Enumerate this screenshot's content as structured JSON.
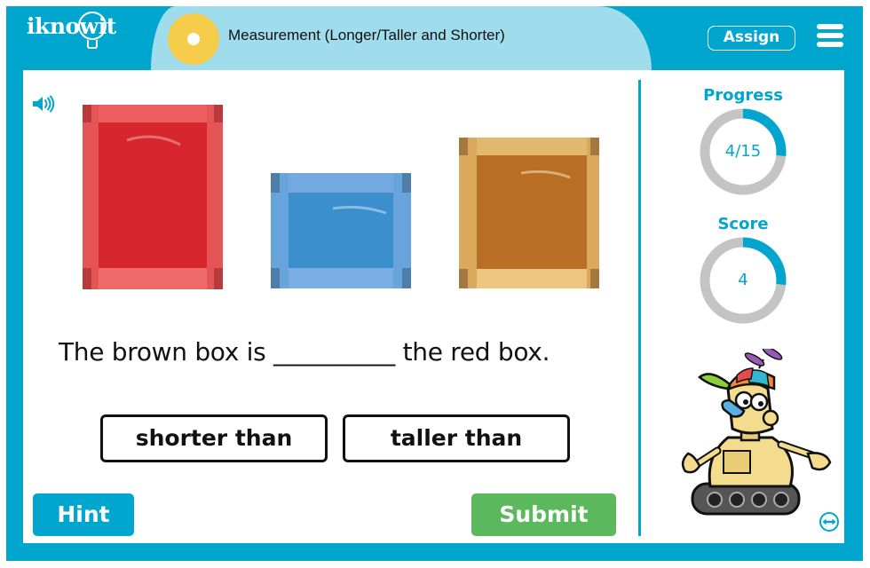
{
  "header": {
    "logo_text": "iknowit",
    "lesson_title": "Measurement (Longer/Taller and Shorter)",
    "assign_label": "Assign",
    "menu_icon": "hamburger-menu-icon"
  },
  "question": {
    "audio_icon": "speaker-icon",
    "images": [
      {
        "name": "red box",
        "color": "#e0393d"
      },
      {
        "name": "blue box",
        "color": "#3f93cf"
      },
      {
        "name": "brown box",
        "color": "#c07a30"
      }
    ],
    "prompt": "The brown box is __________ the red box.",
    "choices": [
      "shorter than",
      "taller than"
    ]
  },
  "actions": {
    "hint_label": "Hint",
    "submit_label": "Submit"
  },
  "sidebar": {
    "progress_label": "Progress",
    "progress_text": "4/15",
    "progress_value": 4,
    "progress_total": 15,
    "score_label": "Score",
    "score_text": "4",
    "score_value": 4,
    "score_total": 15,
    "expand_icon": "resize-arrows-icon"
  },
  "colors": {
    "brand": "#00a6ce",
    "title_bg": "#9fdcec",
    "title_dot": "#f5cd4b",
    "submit": "#5cb85c",
    "ring_track": "#c4c4c4",
    "ring_fill": "#00a6ce"
  }
}
